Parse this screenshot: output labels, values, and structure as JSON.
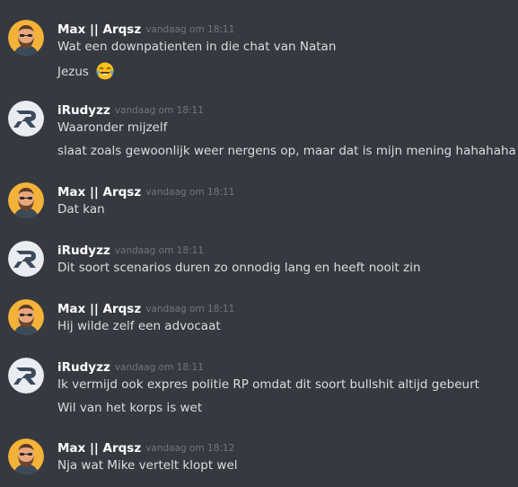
{
  "messages": [
    {
      "author": "Max || Arqsz",
      "time": "vandaag om 18:11",
      "avatar": "bearded-man-avatar",
      "lines": [
        "Wat een downpatienten in die chat van Natan",
        "Jezus"
      ],
      "emoji": "joy-emoji"
    },
    {
      "author": "iRudyzz",
      "time": "vandaag om 18:11",
      "avatar": "r-logo-avatar",
      "lines": [
        "Waaronder mijzelf",
        "slaat zoals gewoonlijk weer nergens op, maar dat is mijn mening hahahaha"
      ]
    },
    {
      "author": "Max || Arqsz",
      "time": "vandaag om 18:11",
      "avatar": "bearded-man-avatar",
      "lines": [
        "Dat kan"
      ]
    },
    {
      "author": "iRudyzz",
      "time": "vandaag om 18:11",
      "avatar": "r-logo-avatar",
      "lines": [
        "Dit soort scenarios duren zo onnodig lang en heeft nooit zin"
      ]
    },
    {
      "author": "Max || Arqsz",
      "time": "vandaag om 18:11",
      "avatar": "bearded-man-avatar",
      "lines": [
        "Hij wilde zelf een advocaat"
      ]
    },
    {
      "author": "iRudyzz",
      "time": "vandaag om 18:11",
      "avatar": "r-logo-avatar",
      "lines": [
        "Ik vermijd ook expres politie RP omdat dit soort bullshit altijd gebeurt",
        "Wil van het korps is wet"
      ]
    },
    {
      "author": "Max || Arqsz",
      "time": "vandaag om 18:12",
      "avatar": "bearded-man-avatar",
      "lines": [
        "Nja wat Mike vertelt klopt wel"
      ]
    }
  ],
  "colors": {
    "background": "#36393f",
    "username": "#ffffff",
    "text": "#dcddde",
    "timestamp": "#72767d",
    "avatar_max_bg": "#f4b338",
    "avatar_rudy_bg": "#e9edf2"
  }
}
